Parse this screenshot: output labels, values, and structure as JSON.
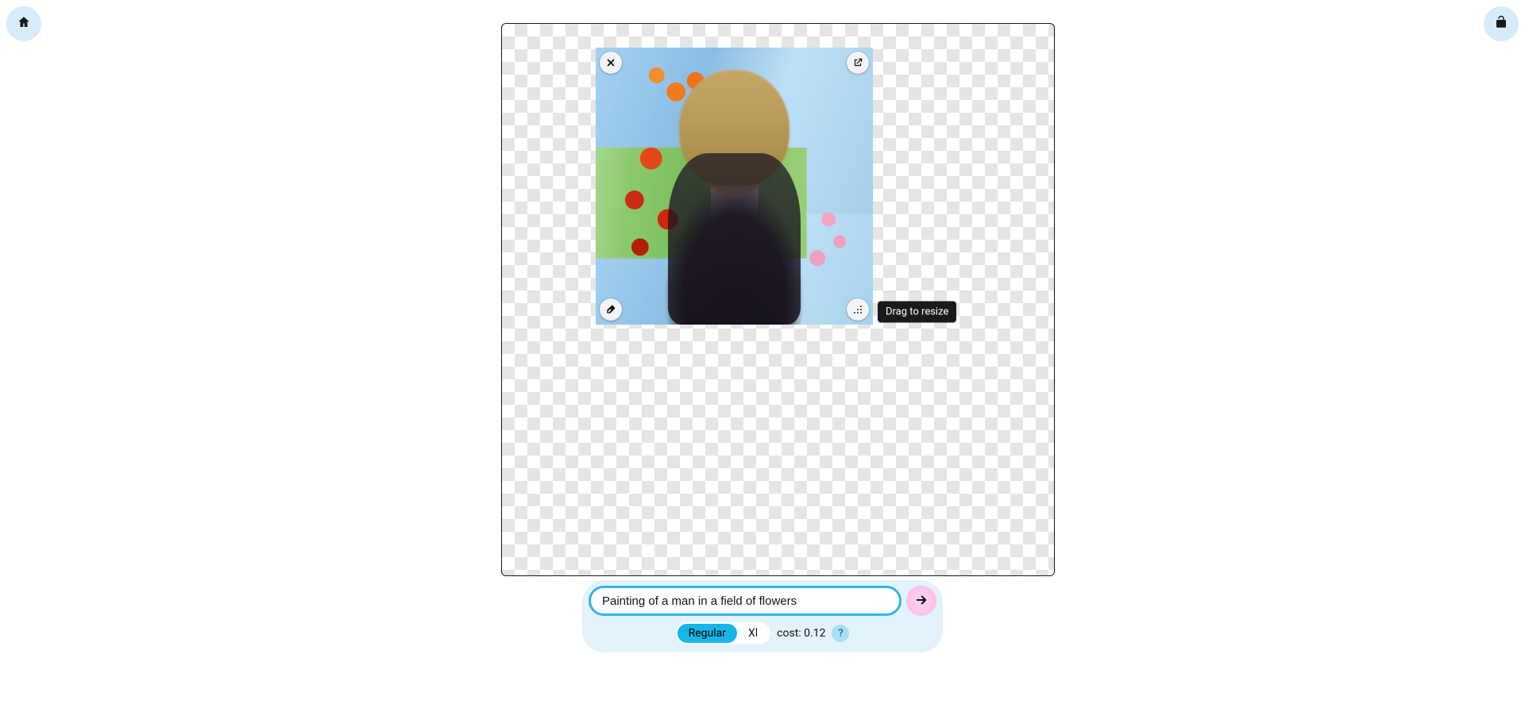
{
  "corner_buttons": {
    "home_icon": "home",
    "lock_icon": "unlock"
  },
  "tile": {
    "tooltip_resize": "Drag to resize",
    "controls": {
      "close": "close",
      "expand": "expand",
      "erase": "erase",
      "resize": "resize-handle"
    }
  },
  "prompt": {
    "value": "Painting of a man in a field of flowers",
    "options": {
      "regular_label": "Regular",
      "xl_label": "Xl"
    },
    "cost_label": "cost: 0.12",
    "help_label": "?"
  }
}
